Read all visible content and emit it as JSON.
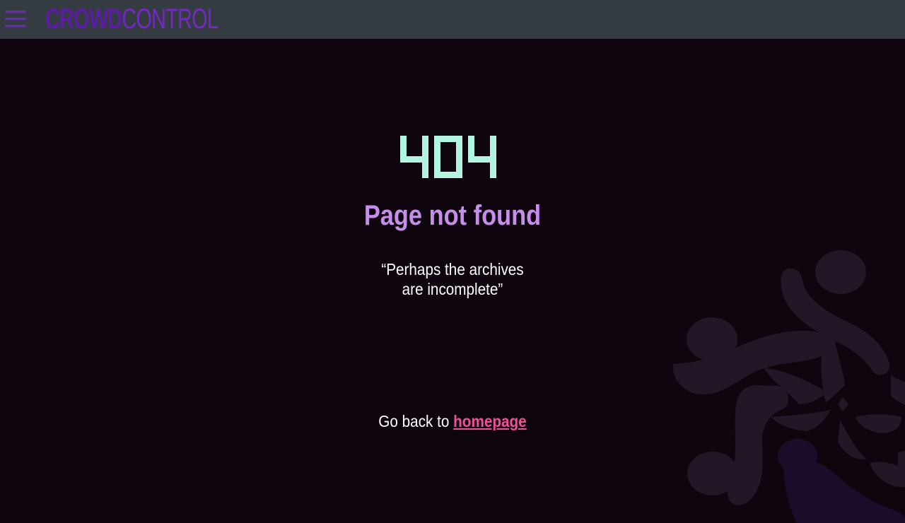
{
  "header": {
    "brand_part1": "CROWD",
    "brand_part2": "CONTROL",
    "menu_icon": "hamburger-menu-icon"
  },
  "main": {
    "code": "404",
    "title": "Page not found",
    "quote_line1": "“Perhaps the archives",
    "quote_line2": "are incomplete”",
    "back_prefix": "Go back to",
    "back_link": "homepage"
  },
  "colors": {
    "page_background": "#0f050e",
    "header_background": "#343c41",
    "brand_primary": "#5c1ea0",
    "brand_secondary": "#7428c4",
    "code_404": "#b4f5e1",
    "title": "#c78ded",
    "text": "#ffffff",
    "link": "#f0509a",
    "background_logo": "#221627"
  }
}
